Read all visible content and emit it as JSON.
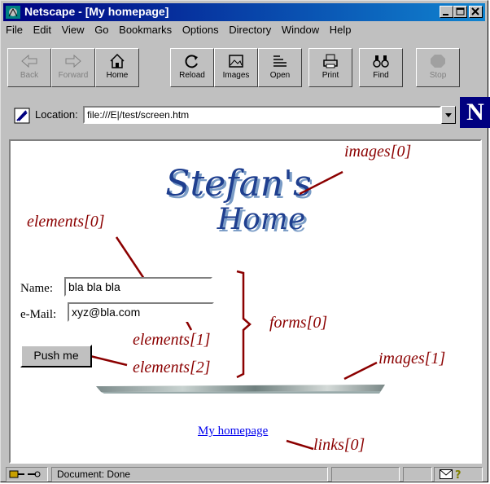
{
  "window": {
    "title": "Netscape - [My homepage]"
  },
  "menu": [
    "File",
    "Edit",
    "View",
    "Go",
    "Bookmarks",
    "Options",
    "Directory",
    "Window",
    "Help"
  ],
  "toolbar": {
    "back": "Back",
    "forward": "Forward",
    "home": "Home",
    "reload": "Reload",
    "images": "Images",
    "open": "Open",
    "print": "Print",
    "find": "Find",
    "stop": "Stop"
  },
  "location": {
    "label": "Location:",
    "value": "file:///E|/test/screen.htm"
  },
  "page": {
    "logo_line1": "Stefan's",
    "logo_line2": "Home",
    "name_label": "Name:",
    "name_value": "bla bla bla",
    "email_label": "e-Mail:",
    "email_value": "xyz@bla.com",
    "button_label": "Push me",
    "link_text": "My homepage"
  },
  "annotations": {
    "images0": "images[0]",
    "elements0": "elements[0]",
    "elements1": "elements[1]",
    "elements2": "elements[2]",
    "forms0": "forms[0]",
    "images1": "images[1]",
    "links0": "links[0]"
  },
  "colors": {
    "annotation": "#8b0000",
    "titlebar": "#000080",
    "link": "#0000ee"
  },
  "status": {
    "text": "Document: Done"
  }
}
